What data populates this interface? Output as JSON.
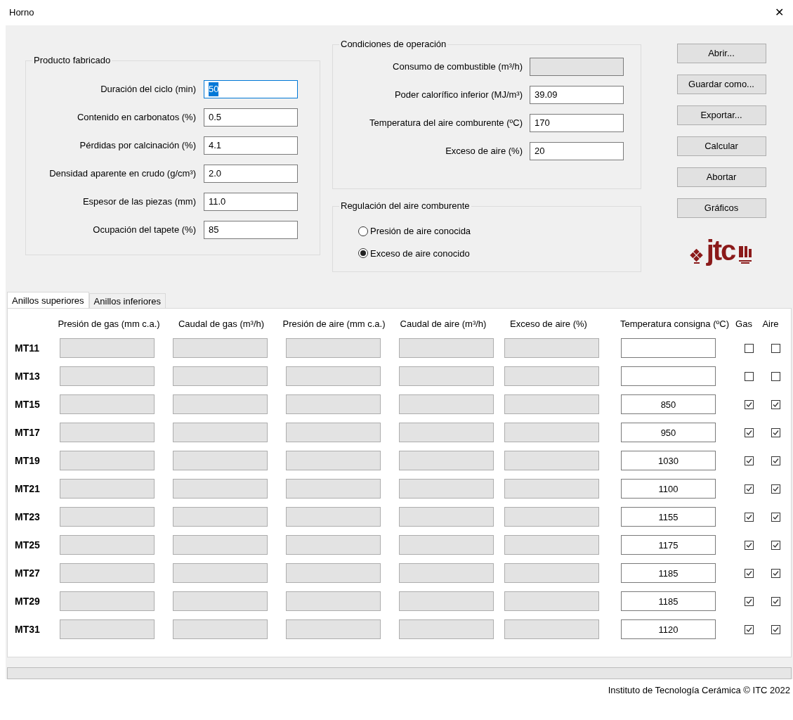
{
  "window": {
    "title": "Horno",
    "close": "✕"
  },
  "producto": {
    "title": "Producto fabricado",
    "fields": [
      {
        "label": "Duración del ciclo (min)",
        "value": "50",
        "focused": true
      },
      {
        "label": "Contenido en carbonatos (%)",
        "value": "0.5",
        "focused": false
      },
      {
        "label": "Pérdidas por calcinación (%)",
        "value": "4.1",
        "focused": false
      },
      {
        "label": "Densidad aparente en crudo (g/cm³)",
        "value": "2.0",
        "focused": false
      },
      {
        "label": "Espesor de las piezas (mm)",
        "value": "11.0",
        "focused": false
      },
      {
        "label": "Ocupación del tapete (%)",
        "value": "85",
        "focused": false
      }
    ]
  },
  "condiciones": {
    "title": "Condiciones de operación",
    "fields": [
      {
        "label": "Consumo de combustible (m³/h)",
        "disabled": true
      },
      {
        "label": "Poder calorífico inferior (MJ/m³)",
        "value": "39.09",
        "disabled": false
      },
      {
        "label": "Temperatura del aire comburente (ºC)",
        "value": "170",
        "disabled": false
      },
      {
        "label": "Exceso de aire (%)",
        "value": "20",
        "disabled": false
      }
    ]
  },
  "regulacion": {
    "title": "Regulación del aire comburente",
    "options": [
      {
        "label": "Presión de aire conocida",
        "selected": false
      },
      {
        "label": "Exceso de aire conocido",
        "selected": true
      }
    ]
  },
  "buttons": [
    "Abrir...",
    "Guardar como...",
    "Exportar...",
    "Calcular",
    "Abortar",
    "Gráficos"
  ],
  "logo": {
    "text": "jtc"
  },
  "tabs": [
    {
      "label": "Anillos superiores",
      "selected": true
    },
    {
      "label": "Anillos inferiores",
      "selected": false
    }
  ],
  "table": {
    "columns": [
      "Presión de gas (mm c.a.)",
      "Caudal de gas (m³/h)",
      "Presión de aire (mm c.a.)",
      "Caudal de aire (m³/h)",
      "Exceso de aire (%)",
      "Temperatura consigna (ºC)",
      "Gas",
      "Aire"
    ],
    "rows": [
      {
        "name": "MT11",
        "gas": false,
        "aire": false
      },
      {
        "name": "MT13",
        "gas": false,
        "aire": false
      },
      {
        "name": "MT15",
        "temperature": "850",
        "gas": true,
        "aire": true
      },
      {
        "name": "MT17",
        "temperature": "950",
        "gas": true,
        "aire": true
      },
      {
        "name": "MT19",
        "temperature": "1030",
        "gas": true,
        "aire": true
      },
      {
        "name": "MT21",
        "temperature": "1100",
        "gas": true,
        "aire": true
      },
      {
        "name": "MT23",
        "temperature": "1155",
        "gas": true,
        "aire": true
      },
      {
        "name": "MT25",
        "temperature": "1175",
        "gas": true,
        "aire": true
      },
      {
        "name": "MT27",
        "temperature": "1185",
        "gas": true,
        "aire": true
      },
      {
        "name": "MT29",
        "temperature": "1185",
        "gas": true,
        "aire": true
      },
      {
        "name": "MT31",
        "temperature": "1120",
        "gas": true,
        "aire": true
      }
    ]
  },
  "status_bar": "Instituto de Tecnología Cerámica © ITC 2022"
}
